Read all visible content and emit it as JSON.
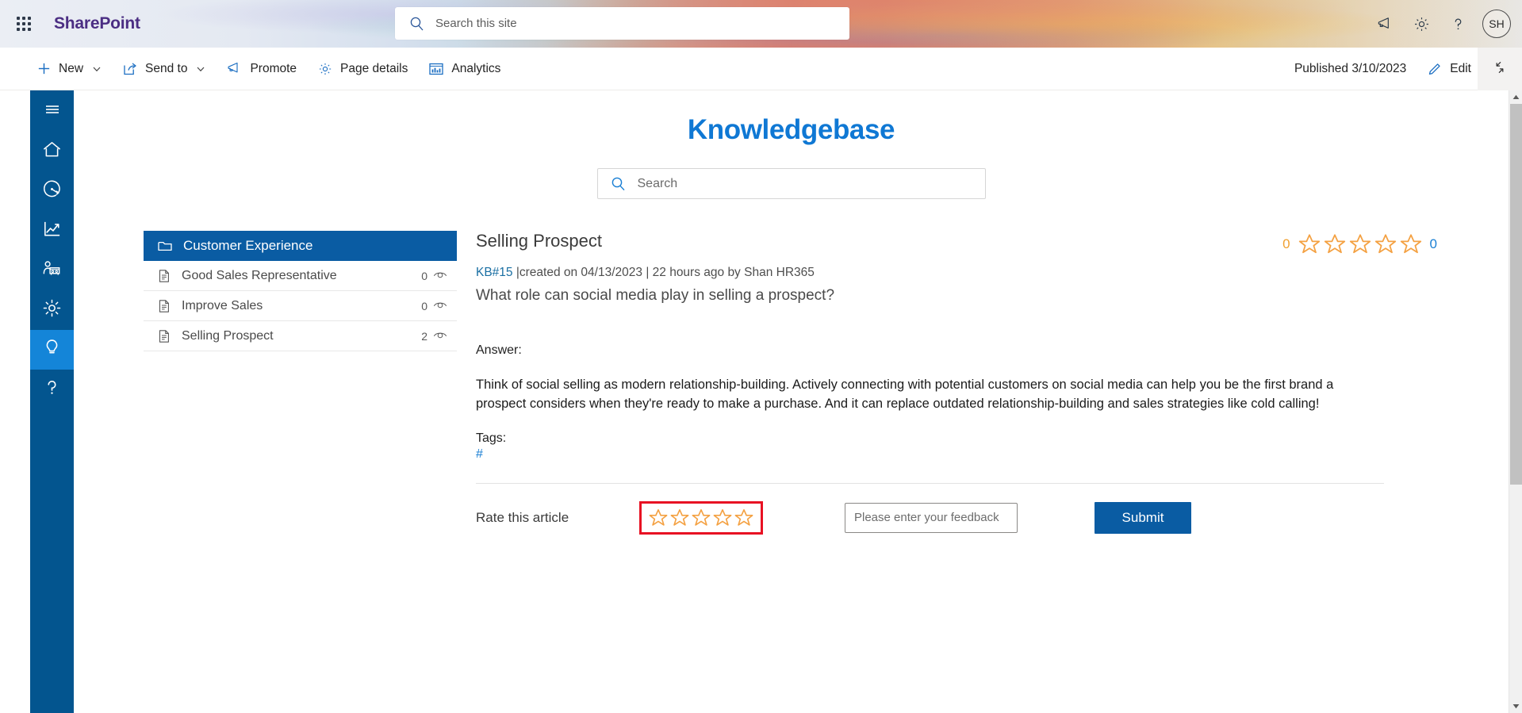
{
  "suite": {
    "app_launcher": "waffle-menu",
    "brand": "SharePoint",
    "search_placeholder": "Search this site",
    "icons": [
      {
        "name": "megaphone-icon",
        "label": "What's new"
      },
      {
        "name": "gear-icon",
        "label": "Settings"
      },
      {
        "name": "help-icon",
        "label": "Help"
      }
    ],
    "avatar_initials": "SH"
  },
  "command_bar": {
    "items": [
      {
        "label": "New",
        "icon": "plus-icon",
        "has_chevron": true
      },
      {
        "label": "Send to",
        "icon": "send-to-icon",
        "has_chevron": true
      },
      {
        "label": "Promote",
        "icon": "megaphone-icon",
        "has_chevron": false
      },
      {
        "label": "Page details",
        "icon": "gear-icon",
        "has_chevron": false
      },
      {
        "label": "Analytics",
        "icon": "analytics-icon",
        "has_chevron": false
      }
    ],
    "published_status": "Published 3/10/2023",
    "edit_label": "Edit",
    "collapse_label": "collapse-icon"
  },
  "nav_rail": {
    "items": [
      {
        "name": "hamburger-icon",
        "label": "Menu",
        "selected": false
      },
      {
        "name": "home-icon",
        "label": "Home",
        "selected": false
      },
      {
        "name": "gauge-icon",
        "label": "Dashboard",
        "selected": false
      },
      {
        "name": "chart-trend-icon",
        "label": "Reports",
        "selected": false
      },
      {
        "name": "people-presentation-icon",
        "label": "Teams",
        "selected": false
      },
      {
        "name": "gear-icon",
        "label": "Settings",
        "selected": false
      },
      {
        "name": "lightbulb-icon",
        "label": "Knowledgebase",
        "selected": true
      },
      {
        "name": "help-icon",
        "label": "Help",
        "selected": false
      }
    ],
    "background_color": "#03558f",
    "selected_color": "#1485d8"
  },
  "page": {
    "title": "Knowledgebase",
    "title_color": "#0f78d4",
    "search_placeholder": "Search",
    "search_value": ""
  },
  "category_panel": {
    "header": {
      "label": "Customer Experience",
      "icon": "folder-icon",
      "background_color": "#0a5ca3"
    },
    "articles": [
      {
        "title": "Good Sales Representative",
        "views": "0",
        "icon": "document-icon",
        "views_icon": "eye-icon"
      },
      {
        "title": "Improve Sales",
        "views": "0",
        "icon": "document-icon",
        "views_icon": "eye-icon"
      },
      {
        "title": "Selling Prospect",
        "views": "2",
        "icon": "document-icon",
        "views_icon": "eye-icon"
      }
    ]
  },
  "article": {
    "title": "Selling Prospect",
    "kb_id": "KB#15",
    "meta_rest": " |created on 04/13/2023 | 22 hours ago by Shan HR365",
    "question": "What role can social media play in selling a prospect?",
    "answer_label": "Answer:",
    "answer_body": "Think of social selling as modern relationship-building. Actively connecting with potential customers on social media can help you be the first brand a prospect considers when they're ready to make a purchase. And it can replace outdated relationship-building and sales strategies like cold calling!",
    "tags_label": "Tags:",
    "tags_value": "#",
    "rating": {
      "count_left": "0",
      "count_right": "0",
      "stars_total": 5,
      "stars_filled": 0,
      "star_color": "#f4a142",
      "count_left_color": "#f0a030",
      "count_right_color": "#1a7fd4"
    }
  },
  "rate_section": {
    "label": "Rate this article",
    "stars_total": 5,
    "stars_filled": 0,
    "highlight_color": "#e81123",
    "feedback_placeholder": "Please enter your feedback",
    "feedback_value": "",
    "submit_label": "Submit",
    "submit_color": "#0a5ca3"
  }
}
